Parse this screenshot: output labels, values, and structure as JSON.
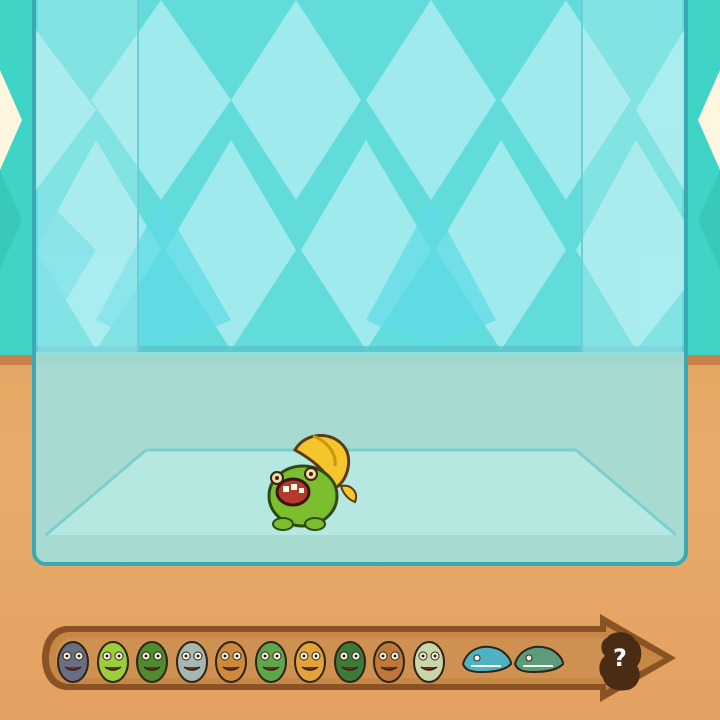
{
  "scene": {
    "name": "creature-tank",
    "wallpaper_colors": [
      "#3fd4c6",
      "#fff7e0"
    ],
    "glass_color": "#7de2eb",
    "floor_color": "#e6a463"
  },
  "tank_creature": {
    "name": "green-frog-monster-with-banana",
    "icon": "banana-monster-icon"
  },
  "collection": {
    "unlocked": [
      {
        "icon": "grey-robot-monster-icon",
        "color": "#6b6e80"
      },
      {
        "icon": "banana-monster-icon",
        "color": "#9ccd3c"
      },
      {
        "icon": "green-frog-tire-icon",
        "color": "#4f8a2e"
      },
      {
        "icon": "jar-monster-icon",
        "color": "#a6b6b0"
      },
      {
        "icon": "orange-box-monster-icon",
        "color": "#d0893a"
      },
      {
        "icon": "green-hairy-monster-icon",
        "color": "#5fa64a"
      },
      {
        "icon": "orange-ball-monster-icon",
        "color": "#e5a23b"
      },
      {
        "icon": "dark-green-ogre-icon",
        "color": "#3d7a3a"
      },
      {
        "icon": "brown-furry-monster-icon",
        "color": "#c0773a"
      },
      {
        "icon": "ballerina-zombie-icon",
        "color": "#c9d6a8"
      },
      {
        "icon": "shark-monster-icon",
        "color": "#4fb2c0"
      },
      {
        "icon": "crocodile-plane-icon",
        "color": "#5c9b7c"
      }
    ],
    "locked_label": "?",
    "locked_icon": "mystery-silhouette-icon",
    "track_color": "#c78845",
    "track_border_color": "#8a5326"
  }
}
